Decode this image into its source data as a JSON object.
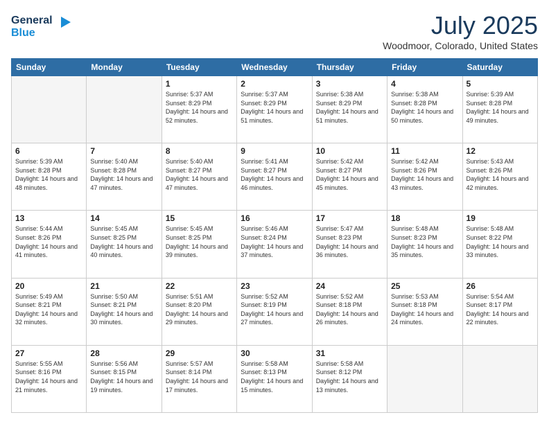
{
  "header": {
    "logo_line1": "General",
    "logo_line2": "Blue",
    "month": "July 2025",
    "location": "Woodmoor, Colorado, United States"
  },
  "days_of_week": [
    "Sunday",
    "Monday",
    "Tuesday",
    "Wednesday",
    "Thursday",
    "Friday",
    "Saturday"
  ],
  "weeks": [
    [
      {
        "day": "",
        "empty": true
      },
      {
        "day": "",
        "empty": true
      },
      {
        "day": "1",
        "sunrise": "Sunrise: 5:37 AM",
        "sunset": "Sunset: 8:29 PM",
        "daylight": "Daylight: 14 hours and 52 minutes."
      },
      {
        "day": "2",
        "sunrise": "Sunrise: 5:37 AM",
        "sunset": "Sunset: 8:29 PM",
        "daylight": "Daylight: 14 hours and 51 minutes."
      },
      {
        "day": "3",
        "sunrise": "Sunrise: 5:38 AM",
        "sunset": "Sunset: 8:29 PM",
        "daylight": "Daylight: 14 hours and 51 minutes."
      },
      {
        "day": "4",
        "sunrise": "Sunrise: 5:38 AM",
        "sunset": "Sunset: 8:28 PM",
        "daylight": "Daylight: 14 hours and 50 minutes."
      },
      {
        "day": "5",
        "sunrise": "Sunrise: 5:39 AM",
        "sunset": "Sunset: 8:28 PM",
        "daylight": "Daylight: 14 hours and 49 minutes."
      }
    ],
    [
      {
        "day": "6",
        "sunrise": "Sunrise: 5:39 AM",
        "sunset": "Sunset: 8:28 PM",
        "daylight": "Daylight: 14 hours and 48 minutes."
      },
      {
        "day": "7",
        "sunrise": "Sunrise: 5:40 AM",
        "sunset": "Sunset: 8:28 PM",
        "daylight": "Daylight: 14 hours and 47 minutes."
      },
      {
        "day": "8",
        "sunrise": "Sunrise: 5:40 AM",
        "sunset": "Sunset: 8:27 PM",
        "daylight": "Daylight: 14 hours and 47 minutes."
      },
      {
        "day": "9",
        "sunrise": "Sunrise: 5:41 AM",
        "sunset": "Sunset: 8:27 PM",
        "daylight": "Daylight: 14 hours and 46 minutes."
      },
      {
        "day": "10",
        "sunrise": "Sunrise: 5:42 AM",
        "sunset": "Sunset: 8:27 PM",
        "daylight": "Daylight: 14 hours and 45 minutes."
      },
      {
        "day": "11",
        "sunrise": "Sunrise: 5:42 AM",
        "sunset": "Sunset: 8:26 PM",
        "daylight": "Daylight: 14 hours and 43 minutes."
      },
      {
        "day": "12",
        "sunrise": "Sunrise: 5:43 AM",
        "sunset": "Sunset: 8:26 PM",
        "daylight": "Daylight: 14 hours and 42 minutes."
      }
    ],
    [
      {
        "day": "13",
        "sunrise": "Sunrise: 5:44 AM",
        "sunset": "Sunset: 8:26 PM",
        "daylight": "Daylight: 14 hours and 41 minutes."
      },
      {
        "day": "14",
        "sunrise": "Sunrise: 5:45 AM",
        "sunset": "Sunset: 8:25 PM",
        "daylight": "Daylight: 14 hours and 40 minutes."
      },
      {
        "day": "15",
        "sunrise": "Sunrise: 5:45 AM",
        "sunset": "Sunset: 8:25 PM",
        "daylight": "Daylight: 14 hours and 39 minutes."
      },
      {
        "day": "16",
        "sunrise": "Sunrise: 5:46 AM",
        "sunset": "Sunset: 8:24 PM",
        "daylight": "Daylight: 14 hours and 37 minutes."
      },
      {
        "day": "17",
        "sunrise": "Sunrise: 5:47 AM",
        "sunset": "Sunset: 8:23 PM",
        "daylight": "Daylight: 14 hours and 36 minutes."
      },
      {
        "day": "18",
        "sunrise": "Sunrise: 5:48 AM",
        "sunset": "Sunset: 8:23 PM",
        "daylight": "Daylight: 14 hours and 35 minutes."
      },
      {
        "day": "19",
        "sunrise": "Sunrise: 5:48 AM",
        "sunset": "Sunset: 8:22 PM",
        "daylight": "Daylight: 14 hours and 33 minutes."
      }
    ],
    [
      {
        "day": "20",
        "sunrise": "Sunrise: 5:49 AM",
        "sunset": "Sunset: 8:21 PM",
        "daylight": "Daylight: 14 hours and 32 minutes."
      },
      {
        "day": "21",
        "sunrise": "Sunrise: 5:50 AM",
        "sunset": "Sunset: 8:21 PM",
        "daylight": "Daylight: 14 hours and 30 minutes."
      },
      {
        "day": "22",
        "sunrise": "Sunrise: 5:51 AM",
        "sunset": "Sunset: 8:20 PM",
        "daylight": "Daylight: 14 hours and 29 minutes."
      },
      {
        "day": "23",
        "sunrise": "Sunrise: 5:52 AM",
        "sunset": "Sunset: 8:19 PM",
        "daylight": "Daylight: 14 hours and 27 minutes."
      },
      {
        "day": "24",
        "sunrise": "Sunrise: 5:52 AM",
        "sunset": "Sunset: 8:18 PM",
        "daylight": "Daylight: 14 hours and 26 minutes."
      },
      {
        "day": "25",
        "sunrise": "Sunrise: 5:53 AM",
        "sunset": "Sunset: 8:18 PM",
        "daylight": "Daylight: 14 hours and 24 minutes."
      },
      {
        "day": "26",
        "sunrise": "Sunrise: 5:54 AM",
        "sunset": "Sunset: 8:17 PM",
        "daylight": "Daylight: 14 hours and 22 minutes."
      }
    ],
    [
      {
        "day": "27",
        "sunrise": "Sunrise: 5:55 AM",
        "sunset": "Sunset: 8:16 PM",
        "daylight": "Daylight: 14 hours and 21 minutes."
      },
      {
        "day": "28",
        "sunrise": "Sunrise: 5:56 AM",
        "sunset": "Sunset: 8:15 PM",
        "daylight": "Daylight: 14 hours and 19 minutes."
      },
      {
        "day": "29",
        "sunrise": "Sunrise: 5:57 AM",
        "sunset": "Sunset: 8:14 PM",
        "daylight": "Daylight: 14 hours and 17 minutes."
      },
      {
        "day": "30",
        "sunrise": "Sunrise: 5:58 AM",
        "sunset": "Sunset: 8:13 PM",
        "daylight": "Daylight: 14 hours and 15 minutes."
      },
      {
        "day": "31",
        "sunrise": "Sunrise: 5:58 AM",
        "sunset": "Sunset: 8:12 PM",
        "daylight": "Daylight: 14 hours and 13 minutes."
      },
      {
        "day": "",
        "empty": true
      },
      {
        "day": "",
        "empty": true
      }
    ]
  ]
}
